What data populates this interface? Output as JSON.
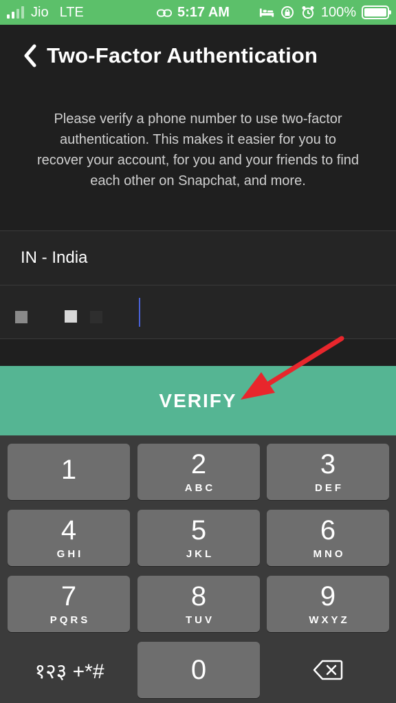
{
  "status_bar": {
    "carrier": "Jio",
    "network": "LTE",
    "time": "5:17 AM",
    "battery": "100%",
    "icons": [
      "link-icon",
      "bed-icon",
      "rotation-lock-icon",
      "alarm-icon"
    ]
  },
  "header": {
    "title": "Two-Factor Authentication"
  },
  "description": "Please verify a phone number to use two-factor authentication. This makes it easier for you to recover your account, for you and your friends to find each other on Snapchat, and more.",
  "country": {
    "value": "IN - India"
  },
  "verify_label": "VERIFY",
  "colors": {
    "status_bar": "#5cc06a",
    "verify": "#55b593",
    "arrow": "#e8262c",
    "caret": "#4a62d8"
  },
  "keypad": {
    "keys": [
      {
        "digit": "1",
        "letters": ""
      },
      {
        "digit": "2",
        "letters": "ABC"
      },
      {
        "digit": "3",
        "letters": "DEF"
      },
      {
        "digit": "4",
        "letters": "GHI"
      },
      {
        "digit": "5",
        "letters": "JKL"
      },
      {
        "digit": "6",
        "letters": "MNO"
      },
      {
        "digit": "7",
        "letters": "PQRS"
      },
      {
        "digit": "8",
        "letters": "TUV"
      },
      {
        "digit": "9",
        "letters": "WXYZ"
      },
      {
        "digit": "0",
        "letters": ""
      }
    ],
    "symbols_label": "१२३ +*#"
  }
}
